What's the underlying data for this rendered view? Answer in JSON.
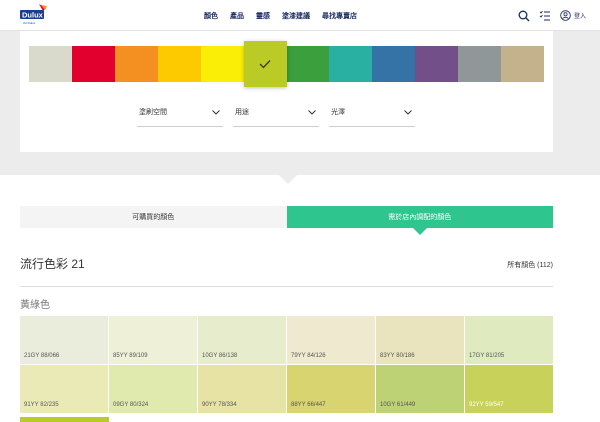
{
  "header": {
    "logo_text": "Dulux",
    "logo_sub": "ICI Dulux",
    "nav": [
      "顏色",
      "產品",
      "靈感",
      "塗漆建議",
      "尋找專賣店"
    ],
    "login_label": "登入",
    "icons": [
      "search-icon",
      "list-icon",
      "user-icon"
    ]
  },
  "colors": {
    "accent": "#2ec58f",
    "selected_swatch": "#b9cb24"
  },
  "swatches": [
    {
      "name": "neutral",
      "color": "#d9d9cc"
    },
    {
      "name": "red",
      "color": "#e2002e"
    },
    {
      "name": "orange",
      "color": "#f39021"
    },
    {
      "name": "amber",
      "color": "#fdca00"
    },
    {
      "name": "yellow",
      "color": "#fbee06"
    },
    {
      "name": "yellow-green",
      "color": "#b9cb24",
      "selected": true
    },
    {
      "name": "green",
      "color": "#3b9f3d"
    },
    {
      "name": "teal",
      "color": "#2ab0a3"
    },
    {
      "name": "blue",
      "color": "#3573a6"
    },
    {
      "name": "purple",
      "color": "#734f8a"
    },
    {
      "name": "grey",
      "color": "#8f9799"
    },
    {
      "name": "beige",
      "color": "#c3b28c"
    }
  ],
  "filters": [
    {
      "label": "塗刷空間"
    },
    {
      "label": "用途"
    },
    {
      "label": "光澤"
    }
  ],
  "tabs": [
    {
      "label": "可購買的顏色",
      "active": false
    },
    {
      "label": "需於店內調配的顏色",
      "active": true
    }
  ],
  "section_title": "流行色彩 21",
  "all_colors_label": "所有顏色 (112)",
  "family_title": "黃綠色",
  "color_grid": [
    {
      "code": "21GY 88/066",
      "hex": "#eaecdc"
    },
    {
      "code": "85YY 89/109",
      "hex": "#eff0d8"
    },
    {
      "code": "10GY 86/138",
      "hex": "#e7edcc"
    },
    {
      "code": "79YY 84/126",
      "hex": "#efe9cf"
    },
    {
      "code": "83YY 80/186",
      "hex": "#e9e4bd"
    },
    {
      "code": "17GY 81/205",
      "hex": "#dfeabf"
    },
    {
      "code": "91YY 82/235",
      "hex": "#eaeab6"
    },
    {
      "code": "09GY 80/324",
      "hex": "#e0e9ae"
    },
    {
      "code": "90YY 78/334",
      "hex": "#e6e3a4"
    },
    {
      "code": "88YY 66/447",
      "hex": "#d8d46f"
    },
    {
      "code": "10GY 61/449",
      "hex": "#bdd275"
    },
    {
      "code": "92YY 59/547",
      "hex": "#c8d25b",
      "light": true
    }
  ]
}
